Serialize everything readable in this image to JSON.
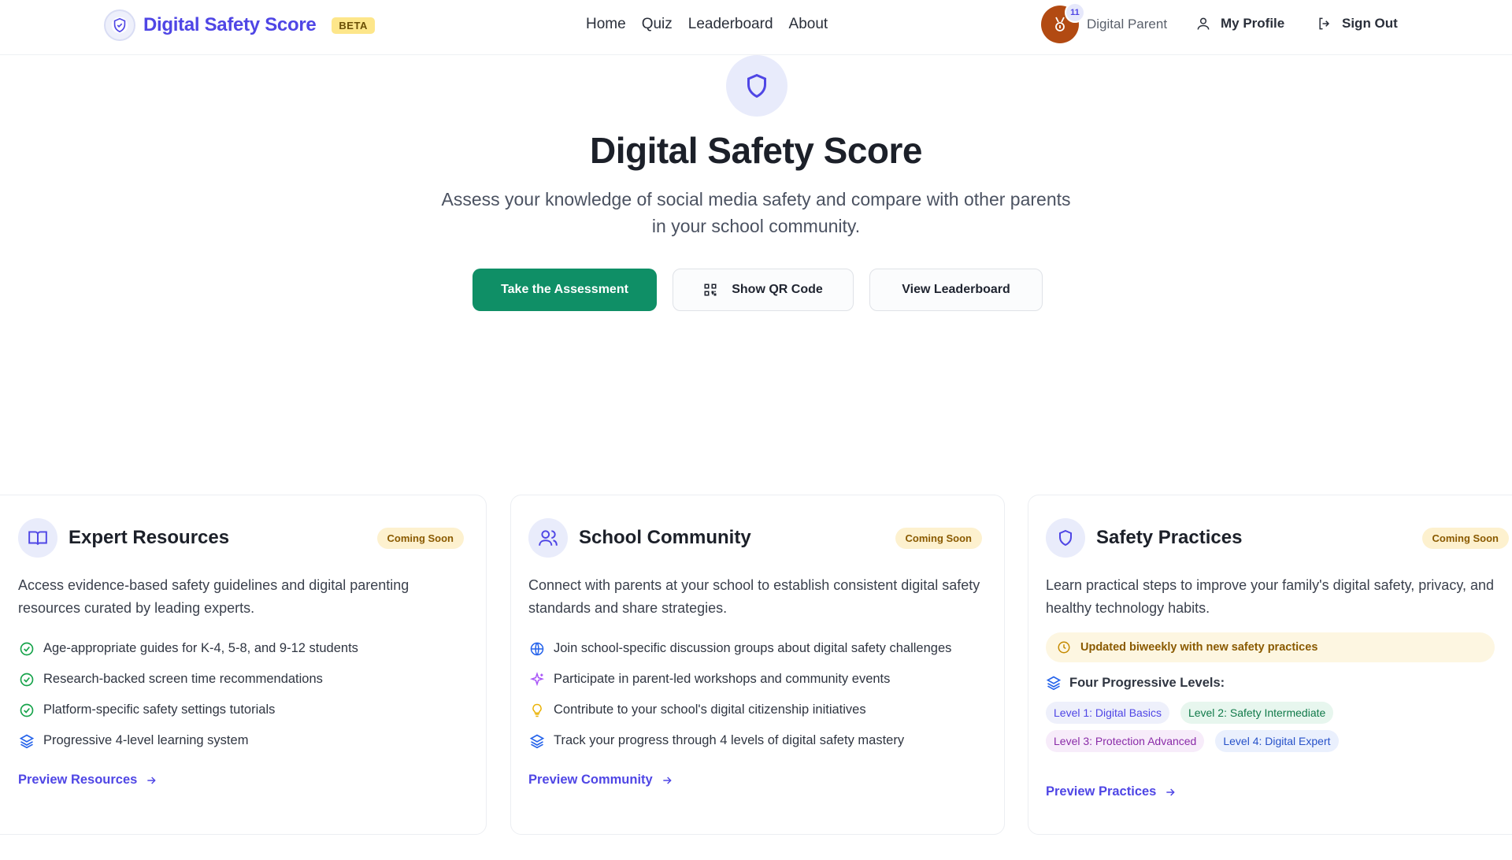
{
  "header": {
    "brand_title": "Digital Safety Score",
    "beta_label": "BETA",
    "nav": [
      {
        "label": "Home"
      },
      {
        "label": "Quiz"
      },
      {
        "label": "Leaderboard"
      },
      {
        "label": "About"
      }
    ],
    "badge_count": "11",
    "user_name": "Digital Parent",
    "profile_label": "My Profile",
    "signout_label": "Sign Out"
  },
  "hero": {
    "title": "Digital Safety Score",
    "subtitle": "Assess your knowledge of social media safety and compare with other parents in your school community.",
    "buttons": {
      "take_assessment": "Take the Assessment",
      "show_qr": "Show QR Code",
      "view_leaderboard": "View Leaderboard"
    }
  },
  "cards": [
    {
      "title": "Expert Resources",
      "badge": "Coming Soon",
      "description": "Access evidence-based safety guidelines and digital parenting resources curated by leading experts.",
      "features": [
        "Age-appropriate guides for K-4, 5-8, and 9-12 students",
        "Research-backed screen time recommendations",
        "Platform-specific safety settings tutorials",
        "Progressive 4-level learning system"
      ],
      "link": "Preview Resources"
    },
    {
      "title": "School Community",
      "badge": "Coming Soon",
      "description": "Connect with parents at your school to establish consistent digital safety standards and share strategies.",
      "features": [
        "Join school-specific discussion groups about digital safety challenges",
        "Participate in parent-led workshops and community events",
        "Contribute to your school's digital citizenship initiatives",
        "Track your progress through 4 levels of digital safety mastery"
      ],
      "link": "Preview Community"
    },
    {
      "title": "Safety Practices",
      "badge": "Coming Soon",
      "description": "Learn practical steps to improve your family's digital safety, privacy, and healthy technology habits.",
      "update_note": "Updated biweekly with new safety practices",
      "levels_heading": "Four Progressive Levels:",
      "levels": [
        "Level 1: Digital Basics",
        "Level 2: Safety Intermediate",
        "Level 3: Protection Advanced",
        "Level 4: Digital Expert"
      ],
      "link": "Preview Practices"
    }
  ],
  "colors": {
    "brand": "#4f46e5",
    "primary_button": "#0f8f66",
    "coming_soon_bg": "#fdf1cf",
    "avatar_badge": "#b24a12"
  }
}
